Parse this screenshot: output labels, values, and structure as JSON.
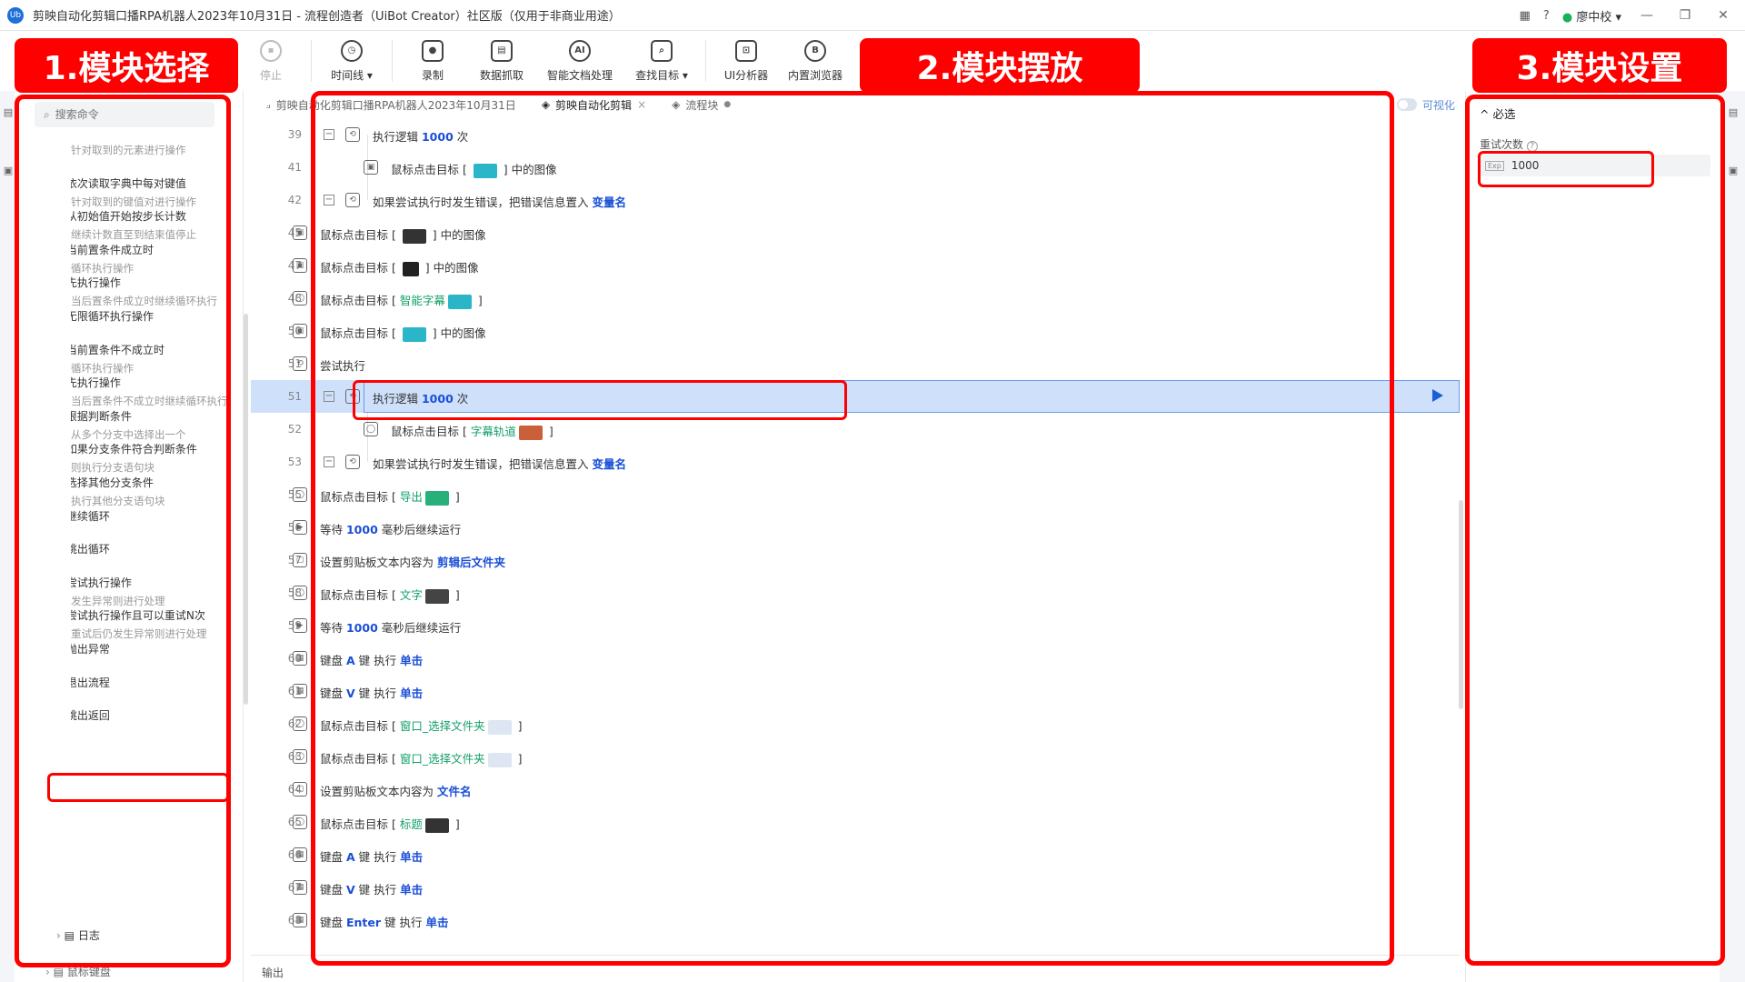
{
  "window": {
    "title": "剪映自动化剪辑口播RPA机器人2023年10月31日 - 流程创造者（UiBot Creator）社区版（仅用于非商业用途）",
    "logo": "Ub",
    "user": "廖中校",
    "help": "?"
  },
  "toolbar": {
    "items": [
      {
        "label": "停止",
        "icon": "stop-icon"
      },
      {
        "label": "时间线 ▾",
        "icon": "clock-icon"
      },
      {
        "label": "录制",
        "icon": "record-icon"
      },
      {
        "label": "数据抓取",
        "icon": "data-scrape-icon"
      },
      {
        "label": "智能文档处理",
        "icon": "ai-doc-icon"
      },
      {
        "label": "查找目标 ▾",
        "icon": "find-target-icon"
      },
      {
        "label": "UI分析器",
        "icon": "ui-analyzer-icon"
      },
      {
        "label": "内置浏览器",
        "icon": "browser-icon"
      }
    ]
  },
  "annotations": {
    "panel1": "1.模块选择",
    "panel2": "2.模块摆放",
    "panel3": "3.模块设置"
  },
  "left": {
    "search_placeholder": "搜索命令",
    "commands": [
      {
        "title": "",
        "desc": "针对取到的元素进行操作"
      },
      {
        "title": "依次读取字典中每对键值",
        "desc": "针对取到的键值对进行操作"
      },
      {
        "title": "从初始值开始按步长计数",
        "desc": "继续计数直至到结束值停止"
      },
      {
        "title": "当前置条件成立时",
        "desc": "循环执行操作"
      },
      {
        "title": "先执行操作",
        "desc": "当后置条件成立时继续循环执行"
      },
      {
        "title": "无限循环执行操作",
        "desc": ""
      },
      {
        "title": "当前置条件不成立时",
        "desc": "循环执行操作"
      },
      {
        "title": "先执行操作",
        "desc": "当后置条件不成立时继续循环执行"
      },
      {
        "title": "根据判断条件",
        "desc": "从多个分支中选择出一个"
      },
      {
        "title": "如果分支条件符合判断条件",
        "desc": "则执行分支语句块"
      },
      {
        "title": "选择其他分支条件",
        "desc": "执行其他分支语句块"
      },
      {
        "title": "继续循环",
        "desc": ""
      },
      {
        "title": "跳出循环",
        "desc": ""
      },
      {
        "title": "尝试执行操作",
        "desc": "发生异常则进行处理"
      },
      {
        "title": "尝试执行操作且可以重试N次",
        "desc": "重试后仍发生异常则进行处理"
      },
      {
        "title": "抛出异常",
        "desc": ""
      },
      {
        "title": "退出流程",
        "desc": ""
      },
      {
        "title": "跳出返回",
        "desc": ""
      }
    ],
    "log_node": "日志",
    "kb_node": "鼠标键盘"
  },
  "tabs": [
    {
      "label": "剪映自动化剪辑口播RPA机器人2023年10月31日",
      "icon": "flowchart-icon"
    },
    {
      "label": "剪映自动化剪辑",
      "icon": "layers-icon",
      "close": "×"
    },
    {
      "label": "流程块",
      "icon": "layers-icon",
      "dot": "●"
    }
  ],
  "visualize_label": "可视化",
  "code_rows": [
    {
      "ln": "39",
      "indent": 1,
      "exp": "−",
      "icon": "loop",
      "parts": [
        [
          "t",
          "执行逻辑 "
        ],
        [
          "v",
          "1000"
        ],
        [
          "t",
          " 次"
        ]
      ]
    },
    {
      "ln": "41",
      "indent": 2,
      "icon": "img",
      "parts": [
        [
          "t",
          "鼠标点击目标 [ "
        ],
        [
          "thumb",
          "#2ab6c8"
        ],
        [
          "t",
          " ] 中的图像"
        ]
      ]
    },
    {
      "ln": "42",
      "indent": 1,
      "exp": "−",
      "icon": "loop",
      "parts": [
        [
          "t",
          "如果尝试执行时发生错误，把错误信息置入 "
        ],
        [
          "v",
          "变量名"
        ]
      ]
    },
    {
      "ln": "45",
      "indent": 0,
      "icon": "img",
      "parts": [
        [
          "t",
          "鼠标点击目标 [ "
        ],
        [
          "thumb",
          "#333333"
        ],
        [
          "t",
          " ] 中的图像"
        ]
      ]
    },
    {
      "ln": "47",
      "indent": 0,
      "icon": "img",
      "parts": [
        [
          "t",
          "鼠标点击目标 [ "
        ],
        [
          "thumb",
          "#222222"
        ],
        [
          "t",
          " ] 中的图像"
        ]
      ]
    },
    {
      "ln": "48",
      "indent": 0,
      "icon": "mouse",
      "parts": [
        [
          "t",
          "鼠标点击目标 [ "
        ],
        [
          "g",
          "智能字幕"
        ],
        [
          "thumb",
          "#2ab6c8"
        ],
        [
          "t",
          " ]"
        ]
      ]
    },
    {
      "ln": "50",
      "indent": 0,
      "icon": "img",
      "parts": [
        [
          "t",
          "鼠标点击目标 [ "
        ],
        [
          "thumb",
          "#2ab6c8"
        ],
        [
          "t",
          " ] 中的图像"
        ]
      ]
    },
    {
      "ln": "51",
      "indent": 0,
      "icon": "loop",
      "parts": [
        [
          "t",
          "尝试执行"
        ]
      ]
    },
    {
      "ln": "51",
      "indent": 1,
      "exp": "−",
      "icon": "loop",
      "selected": true,
      "parts": [
        [
          "t",
          "执行逻辑 "
        ],
        [
          "v",
          "1000"
        ],
        [
          "t",
          " 次"
        ]
      ]
    },
    {
      "ln": "52",
      "indent": 2,
      "icon": "mouse",
      "parts": [
        [
          "t",
          "鼠标点击目标 [ "
        ],
        [
          "g",
          "字幕轨道"
        ],
        [
          "thumb",
          "#c9603a"
        ],
        [
          "t",
          " ]"
        ]
      ]
    },
    {
      "ln": "53",
      "indent": 1,
      "exp": "−",
      "icon": "loop",
      "parts": [
        [
          "t",
          "如果尝试执行时发生错误，把错误信息置入 "
        ],
        [
          "v",
          "变量名"
        ]
      ]
    },
    {
      "ln": "55",
      "indent": 0,
      "icon": "mouse",
      "parts": [
        [
          "t",
          "鼠标点击目标 [ "
        ],
        [
          "g",
          "导出"
        ],
        [
          "thumb",
          "#27b07a"
        ],
        [
          "t",
          " ]"
        ]
      ]
    },
    {
      "ln": "56",
      "indent": 0,
      "icon": "wait",
      "parts": [
        [
          "t",
          "等待 "
        ],
        [
          "v",
          "1000"
        ],
        [
          "t",
          " 毫秒后继续运行"
        ]
      ]
    },
    {
      "ln": "57",
      "indent": 0,
      "icon": "clip",
      "parts": [
        [
          "t",
          "设置剪贴板文本内容为 "
        ],
        [
          "v",
          "剪辑后文件夹"
        ]
      ]
    },
    {
      "ln": "58",
      "indent": 0,
      "icon": "mouse",
      "parts": [
        [
          "t",
          "鼠标点击目标 [ "
        ],
        [
          "g",
          "文字"
        ],
        [
          "thumb",
          "#444444"
        ],
        [
          "t",
          " ]"
        ]
      ]
    },
    {
      "ln": "59",
      "indent": 0,
      "icon": "wait",
      "parts": [
        [
          "t",
          "等待 "
        ],
        [
          "v",
          "1000"
        ],
        [
          "t",
          " 毫秒后继续运行"
        ]
      ]
    },
    {
      "ln": "60",
      "indent": 0,
      "icon": "kb",
      "parts": [
        [
          "t",
          "键盘 "
        ],
        [
          "v",
          "A"
        ],
        [
          "t",
          " 键 执行 "
        ],
        [
          "v",
          "单击"
        ]
      ]
    },
    {
      "ln": "61",
      "indent": 0,
      "icon": "kb",
      "parts": [
        [
          "t",
          "键盘 "
        ],
        [
          "v",
          "V"
        ],
        [
          "t",
          " 键 执行 "
        ],
        [
          "v",
          "单击"
        ]
      ]
    },
    {
      "ln": "62",
      "indent": 0,
      "icon": "mouse",
      "parts": [
        [
          "t",
          "鼠标点击目标 [ "
        ],
        [
          "g",
          "窗口_选择文件夹"
        ],
        [
          "thumb",
          "#dde6f2"
        ],
        [
          "t",
          " ]"
        ]
      ]
    },
    {
      "ln": "63",
      "indent": 0,
      "icon": "mouse",
      "parts": [
        [
          "t",
          "鼠标点击目标 [ "
        ],
        [
          "g",
          "窗口_选择文件夹"
        ],
        [
          "thumb",
          "#dde6f2"
        ],
        [
          "t",
          " ]"
        ]
      ]
    },
    {
      "ln": "64",
      "indent": 0,
      "icon": "clip",
      "parts": [
        [
          "t",
          "设置剪贴板文本内容为 "
        ],
        [
          "v",
          "文件名"
        ]
      ]
    },
    {
      "ln": "65",
      "indent": 0,
      "icon": "mouse",
      "parts": [
        [
          "t",
          "鼠标点击目标 [ "
        ],
        [
          "g",
          "标题"
        ],
        [
          "thumb",
          "#333333"
        ],
        [
          "t",
          " ]"
        ]
      ]
    },
    {
      "ln": "66",
      "indent": 0,
      "icon": "kb",
      "parts": [
        [
          "t",
          "键盘 "
        ],
        [
          "v",
          "A"
        ],
        [
          "t",
          " 键 执行 "
        ],
        [
          "v",
          "单击"
        ]
      ]
    },
    {
      "ln": "67",
      "indent": 0,
      "icon": "kb",
      "parts": [
        [
          "t",
          "键盘 "
        ],
        [
          "v",
          "V"
        ],
        [
          "t",
          " 键 执行 "
        ],
        [
          "v",
          "单击"
        ]
      ]
    },
    {
      "ln": "68",
      "indent": 0,
      "icon": "kb",
      "parts": [
        [
          "t",
          "键盘 "
        ],
        [
          "v",
          "Enter"
        ],
        [
          "t",
          " 键 执行 "
        ],
        [
          "v",
          "单击"
        ]
      ]
    }
  ],
  "output_label": "输出",
  "right": {
    "required_label": "^ 必选",
    "retry_label": "重试次数",
    "retry_help": "?",
    "retry_tag": "Exp",
    "retry_value": "1000"
  }
}
